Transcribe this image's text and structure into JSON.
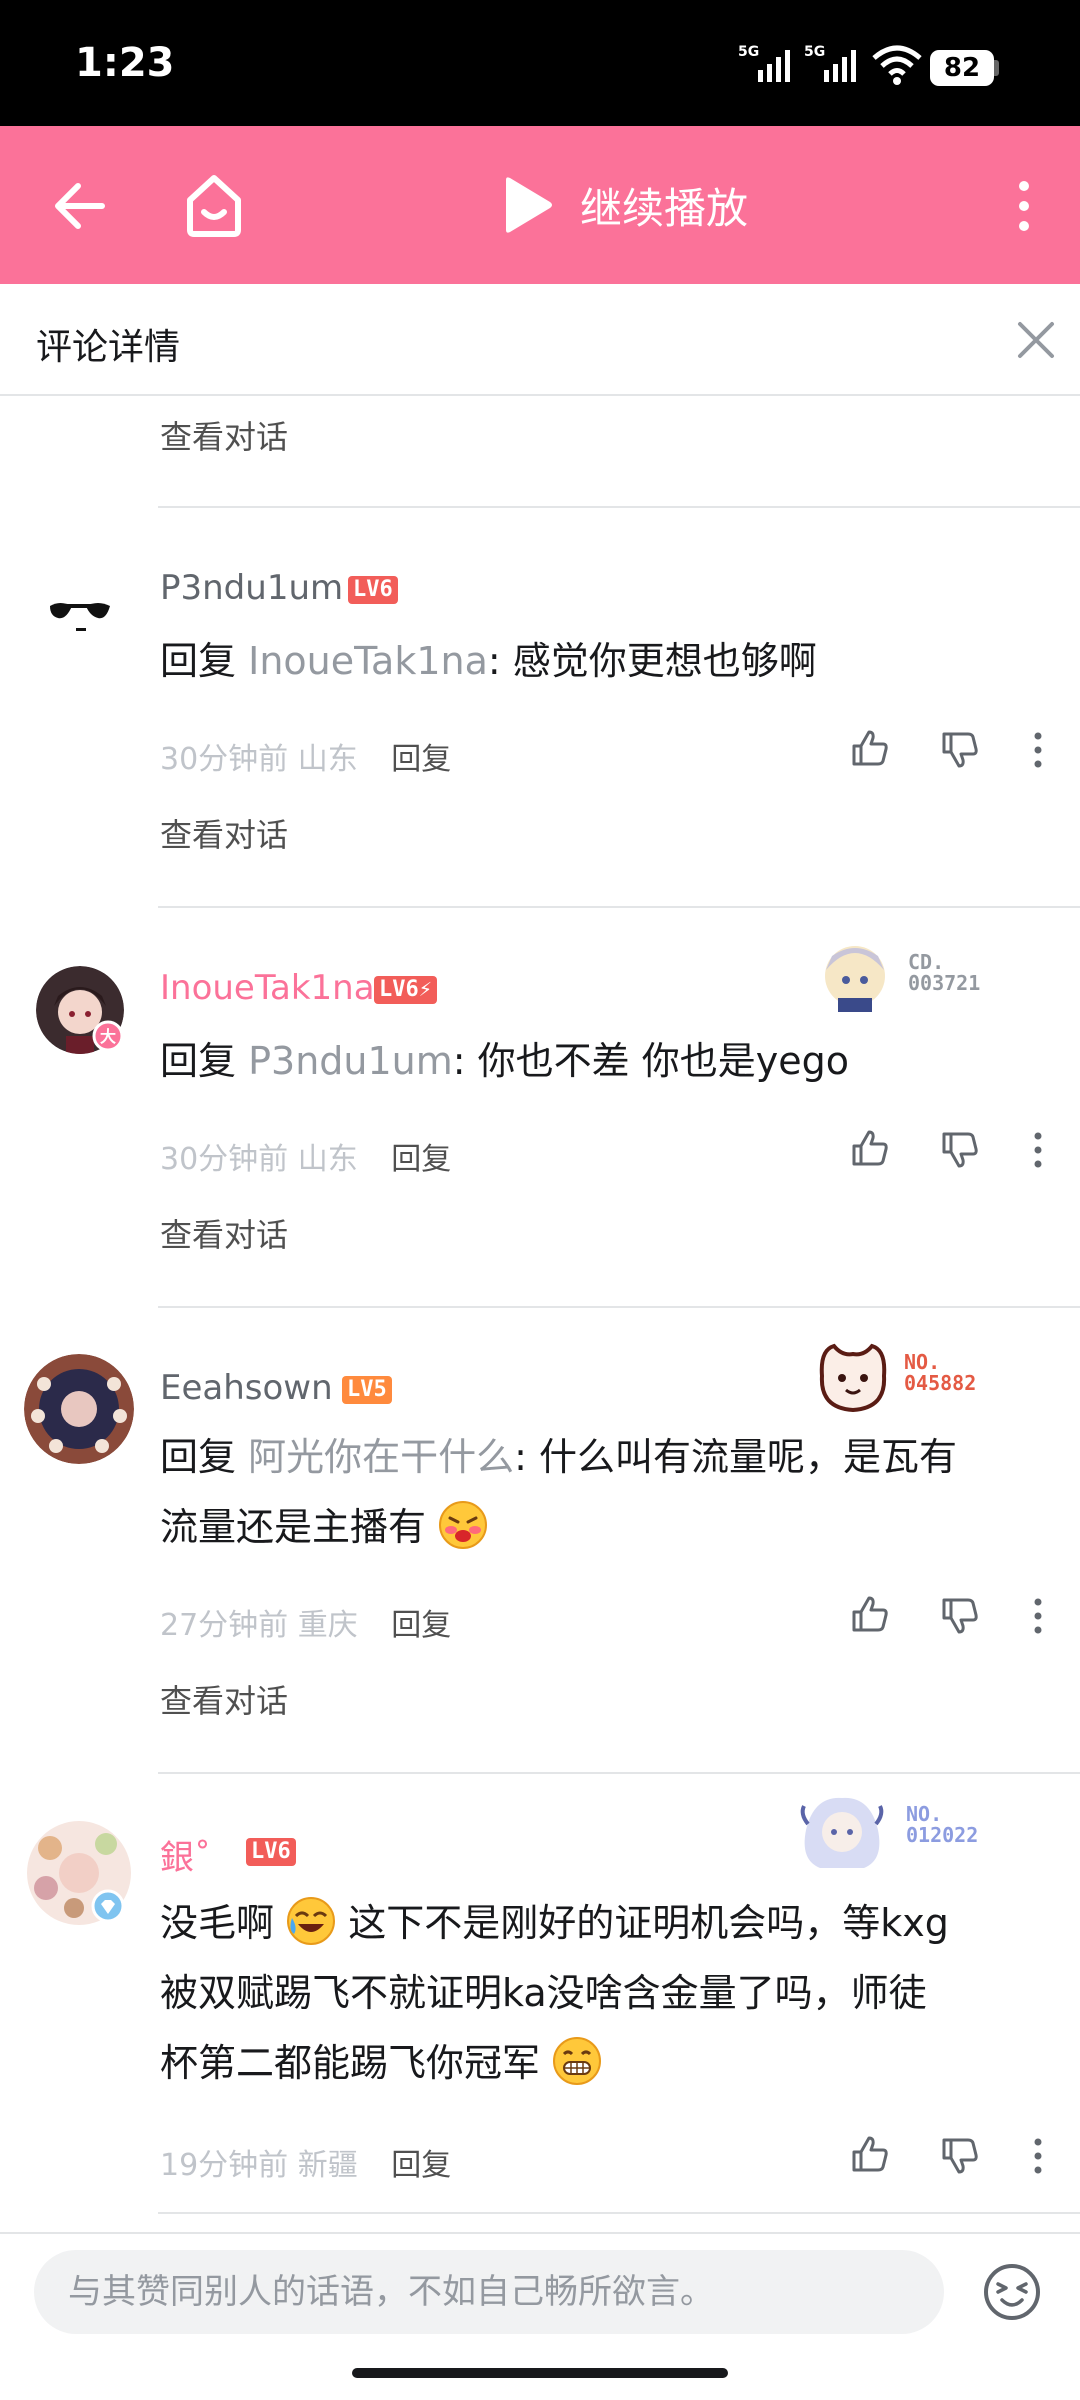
{
  "status_bar": {
    "time": "1:23",
    "network1": "5G",
    "network2": "5G",
    "battery": "82"
  },
  "header": {
    "title": "继续播放",
    "accent": "#fb7299"
  },
  "detail": {
    "title": "评论详情"
  },
  "view_conversation": "查看对话",
  "comments": [
    {
      "username": "P3ndu1um",
      "level": "LV6",
      "reply_prefix": "回复",
      "reply_to": "InoueTak1na",
      "text": ": 感觉你更想也够啊",
      "time": "30分钟前",
      "location": "山东",
      "reply_label": "回复"
    },
    {
      "username": "InoueTak1na",
      "level": "LV6⚡",
      "badge_no": "CD.\n003721",
      "badge_color": "#9499a0",
      "reply_prefix": "回复",
      "reply_to": "P3ndu1um",
      "text": ": 你也不差 你也是yego",
      "time": "30分钟前",
      "location": "山东",
      "reply_label": "回复"
    },
    {
      "username": "Eeahsown",
      "level": "LV5",
      "badge_no": "NO.\n045882",
      "badge_color": "#e45a44",
      "reply_prefix": "回复",
      "reply_to": "阿光你在干什么",
      "text_line1": ": 什么叫有流量呢，是瓦有",
      "text_line2": "流量还是主播有",
      "time": "27分钟前",
      "location": "重庆",
      "reply_label": "回复"
    },
    {
      "username": "銀˚",
      "level": "LV6",
      "badge_no": "NO.\n012022",
      "badge_color": "#8c9ce0",
      "text_a": "没毛啊",
      "text_b": "这下不是刚好的证明机会吗，等kxg",
      "text_c": "被双赋踢飞不就证明ka没啥含金量了吗，师徒",
      "text_d": "杯第二都能踢飞你冠军",
      "time": "19分钟前",
      "location": "新疆",
      "reply_label": "回复"
    }
  ],
  "input": {
    "placeholder": "与其赞同别人的话语，不如自己畅所欲言。"
  }
}
